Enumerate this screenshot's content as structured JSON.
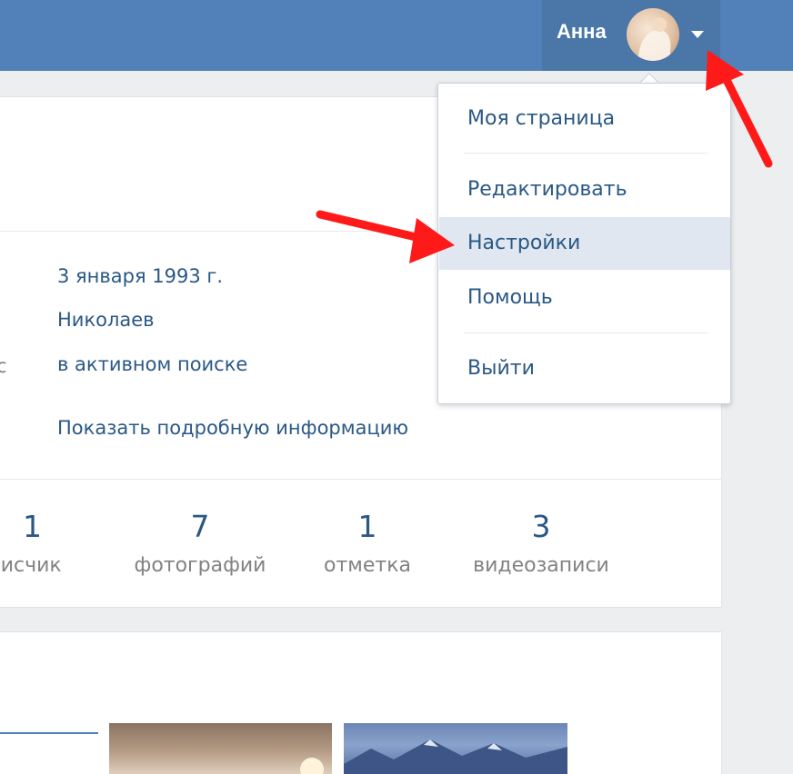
{
  "header": {
    "user_name": "Анна",
    "avatar_icon": "user-avatar",
    "dropdown_icon": "caret-down-icon"
  },
  "profile": {
    "info": {
      "birthday": "3 января 1993 г.",
      "city": "Николаев",
      "status_label_fragment": "c",
      "relationship": "в активном поиске"
    },
    "show_more_link": "Показать подробную информацию",
    "counters": [
      {
        "value": "1",
        "label": "писчик"
      },
      {
        "value": "7",
        "label": "фотографий"
      },
      {
        "value": "1",
        "label": "отметка"
      },
      {
        "value": "3",
        "label": "видеозаписи"
      }
    ]
  },
  "dropdown_menu": {
    "items": [
      {
        "label": "Моя страница"
      },
      {
        "label": "Редактировать"
      },
      {
        "label": "Настройки",
        "highlighted": true
      },
      {
        "label": "Помощь"
      },
      {
        "label": "Выйти"
      }
    ]
  },
  "annotation": {
    "color": "#ff1a1a",
    "arrow_icon": "red-arrow-icon"
  },
  "colors": {
    "header": "#5181b8",
    "header_user": "#4a76a8",
    "link": "#2a5885",
    "muted": "#828282",
    "menu_highlight": "#e0e7f0"
  }
}
